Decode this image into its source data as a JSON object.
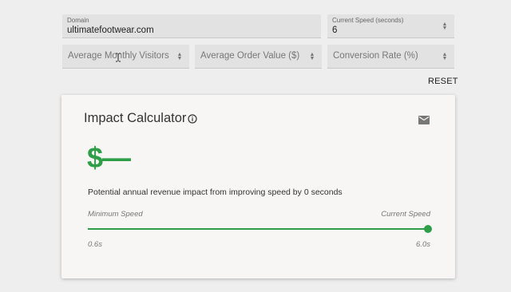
{
  "inputs": {
    "domain": {
      "label": "Domain",
      "value": "ultimatefootwear.com"
    },
    "current_speed": {
      "label": "Current Speed (seconds)",
      "value": "6"
    },
    "monthly_visitors": {
      "placeholder": "Average Monthly Visitors"
    },
    "order_value": {
      "placeholder": "Average Order Value ($)"
    },
    "conversion_rate": {
      "placeholder": "Conversion Rate (%)"
    }
  },
  "reset_label": "RESET",
  "card": {
    "title": "Impact Calculator",
    "value": "$—",
    "description": "Potential annual revenue impact from improving speed by 0 seconds",
    "slider": {
      "min_label": "Minimum Speed",
      "max_label": "Current Speed",
      "min_value": "0.6s",
      "max_value": "6.0s",
      "level": 1.0
    }
  },
  "colors": {
    "accent": "#2e9e49",
    "field_bg": "#e2e2e2",
    "page_bg": "#eeeeee"
  },
  "icons": [
    "info-icon",
    "mail-icon",
    "text-cursor-icon",
    "spinner-arrows-icon"
  ]
}
